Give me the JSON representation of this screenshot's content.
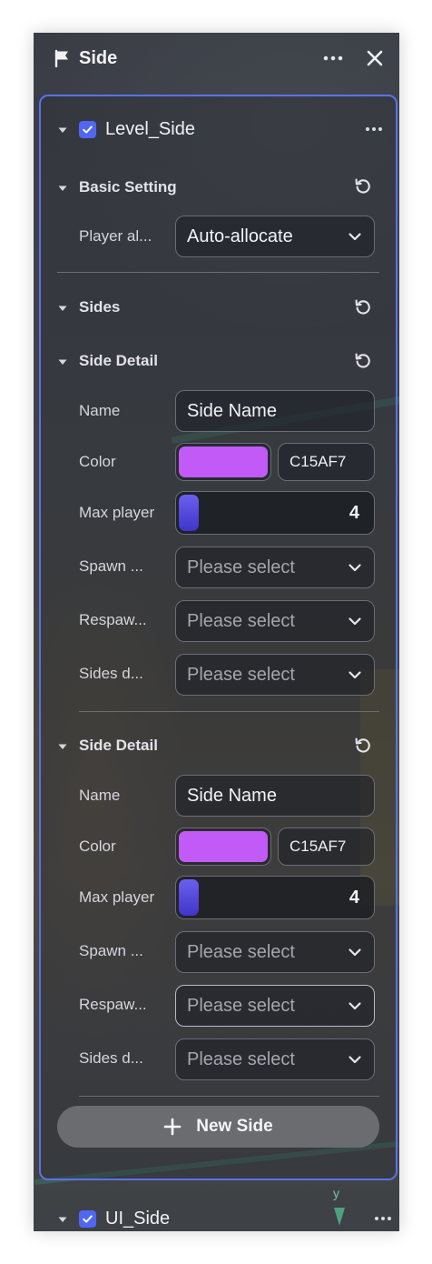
{
  "panel": {
    "title": "Side",
    "header_icons": [
      "flag-icon",
      "more-icon",
      "close-icon"
    ]
  },
  "level_side": {
    "title": "Level_Side",
    "checked": true,
    "basic_setting": {
      "title": "Basic Setting",
      "player_allocation_label": "Player al...",
      "player_allocation_value": "Auto-allocate"
    },
    "sides": {
      "title": "Sides"
    },
    "side_details": [
      {
        "title": "Side Detail",
        "name_label": "Name",
        "name_value": "Side Name",
        "color_label": "Color",
        "color_hex": "C15AF7",
        "color_value": "#c15af7",
        "max_player_label": "Max player",
        "max_player_value": "4",
        "spawn_label": "Spawn ...",
        "spawn_value": "Please select",
        "respawn_label": "Respaw...",
        "respawn_value": "Please select",
        "sides_d_label": "Sides d...",
        "sides_d_value": "Please select"
      },
      {
        "title": "Side Detail",
        "name_label": "Name",
        "name_value": "Side Name",
        "color_label": "Color",
        "color_hex": "C15AF7",
        "color_value": "#c15af7",
        "max_player_label": "Max player",
        "max_player_value": "4",
        "spawn_label": "Spawn ...",
        "spawn_value": "Please select",
        "respawn_label": "Respaw...",
        "respawn_value": "Please select",
        "sides_d_label": "Sides d...",
        "sides_d_value": "Please select"
      }
    ],
    "new_side_label": "New Side"
  },
  "ui_side": {
    "title": "UI_Side",
    "checked": true
  },
  "viewport_axis_label": "y",
  "colors": {
    "accent": "#5166f2",
    "card_border": "#5b72e8",
    "side_color": "#c15af7",
    "axis_green": "#7fbfa8"
  }
}
